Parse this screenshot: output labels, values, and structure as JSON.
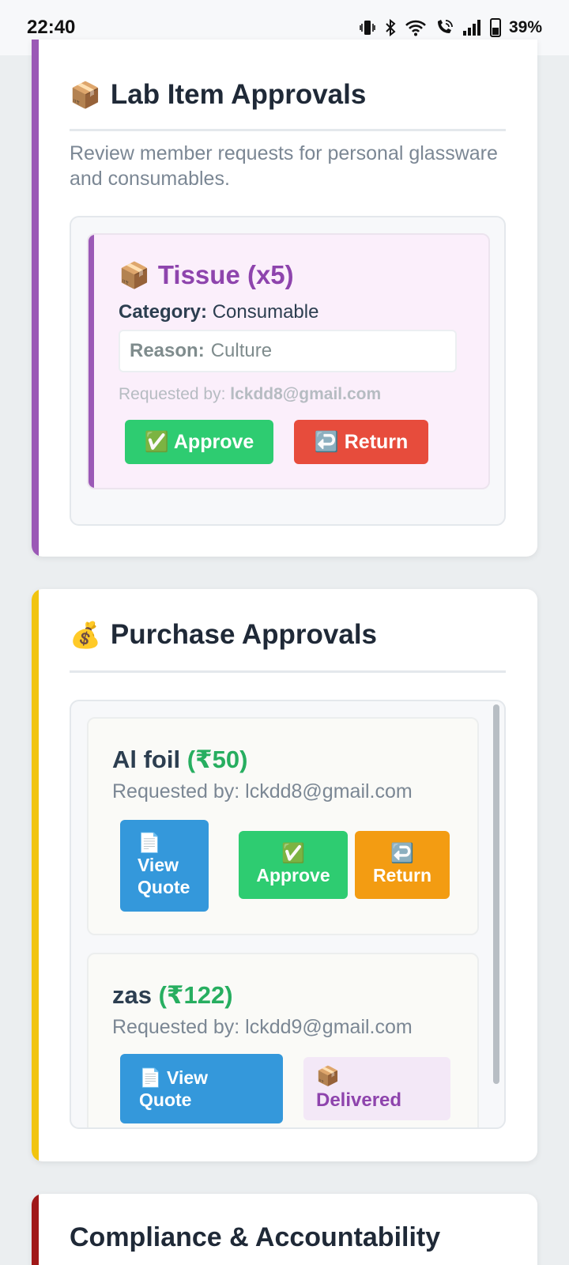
{
  "status_bar": {
    "time": "22:40",
    "battery": "39%",
    "icons": [
      "vibrate-icon",
      "bluetooth-icon",
      "wifi-icon",
      "wifi-call-icon",
      "signal-icon",
      "battery-icon"
    ]
  },
  "lab_section": {
    "emoji": "📦",
    "title": "Lab Item Approvals",
    "description": "Review member requests for personal glassware and consumables.",
    "items": [
      {
        "emoji": "📦",
        "title": "Tissue (x5)",
        "category_label": "Category:",
        "category": "Consumable",
        "reason_label": "Reason:",
        "reason": "Culture",
        "requested_label": "Requested by:",
        "requested_by": "lckdd8@gmail.com",
        "approve_label": "✅ Approve",
        "return_label": "↩️ Return"
      }
    ]
  },
  "purchase_section": {
    "emoji": "💰",
    "title": "Purchase Approvals",
    "items": [
      {
        "name": "Al foil",
        "price": "(₹50)",
        "requested_by": "Requested by: lckdd8@gmail.com",
        "view_quote_icon": "📄",
        "view_quote_line1": "View",
        "view_quote_line2": "Quote",
        "approve_icon": "✅",
        "approve_label": "Approve",
        "return_icon": "↩️",
        "return_label": "Return"
      },
      {
        "name": "zas",
        "price": "(₹122)",
        "requested_by": "Requested by: lckdd9@gmail.com",
        "view_quote_line1": "📄 View",
        "view_quote_line2": "Quote",
        "delivered_icon": "📦",
        "delivered_label": "Delivered"
      }
    ]
  },
  "compliance_section": {
    "title": "Compliance & Accountability"
  },
  "colors": {
    "lab_accent": "#9b59b6",
    "purchase_accent": "#f1c40f",
    "compliance_accent": "#a01818",
    "approve": "#2ecc71",
    "return_red": "#e74c3c",
    "return_orange": "#f39c12",
    "quote_blue": "#3498db",
    "price_green": "#27ae60"
  }
}
